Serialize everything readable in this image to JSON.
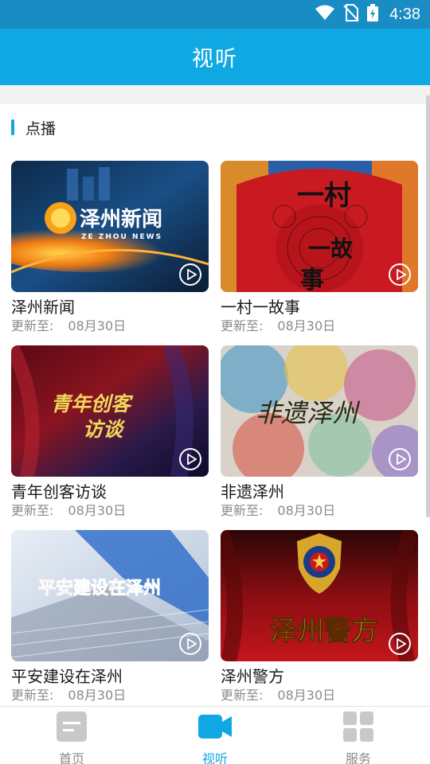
{
  "status_bar": {
    "time": "4:38"
  },
  "app_bar": {
    "title": "视听"
  },
  "section": {
    "title": "点播"
  },
  "cards": [
    {
      "name": "泽州新闻",
      "update_label": "更新至:",
      "date": "08月30日",
      "thumb_text": "泽州新闻",
      "thumb_sub": "ZE ZHOU NEWS"
    },
    {
      "name": "一村一故事",
      "update_label": "更新至:",
      "date": "08月30日",
      "thumb_text": "一村一故事"
    },
    {
      "name": "青年创客访谈",
      "update_label": "更新至:",
      "date": "08月30日",
      "thumb_text": "青年创客",
      "thumb_text2": "访谈"
    },
    {
      "name": "非遗泽州",
      "update_label": "更新至:",
      "date": "08月30日",
      "thumb_text": "非遗泽州"
    },
    {
      "name": "平安建设在泽州",
      "update_label": "更新至:",
      "date": "08月30日",
      "thumb_text": "平安建设在泽州"
    },
    {
      "name": "泽州警方",
      "update_label": "更新至:",
      "date": "08月30日",
      "thumb_text": "泽州警方"
    }
  ],
  "bottom_nav": [
    {
      "label": "首页",
      "icon": "home-icon",
      "active": false
    },
    {
      "label": "视听",
      "icon": "video-camera-icon",
      "active": true
    },
    {
      "label": "服务",
      "icon": "grid-icon",
      "active": false
    }
  ],
  "colors": {
    "accent": "#10a8e3",
    "status_bar": "#1a8cc4"
  }
}
